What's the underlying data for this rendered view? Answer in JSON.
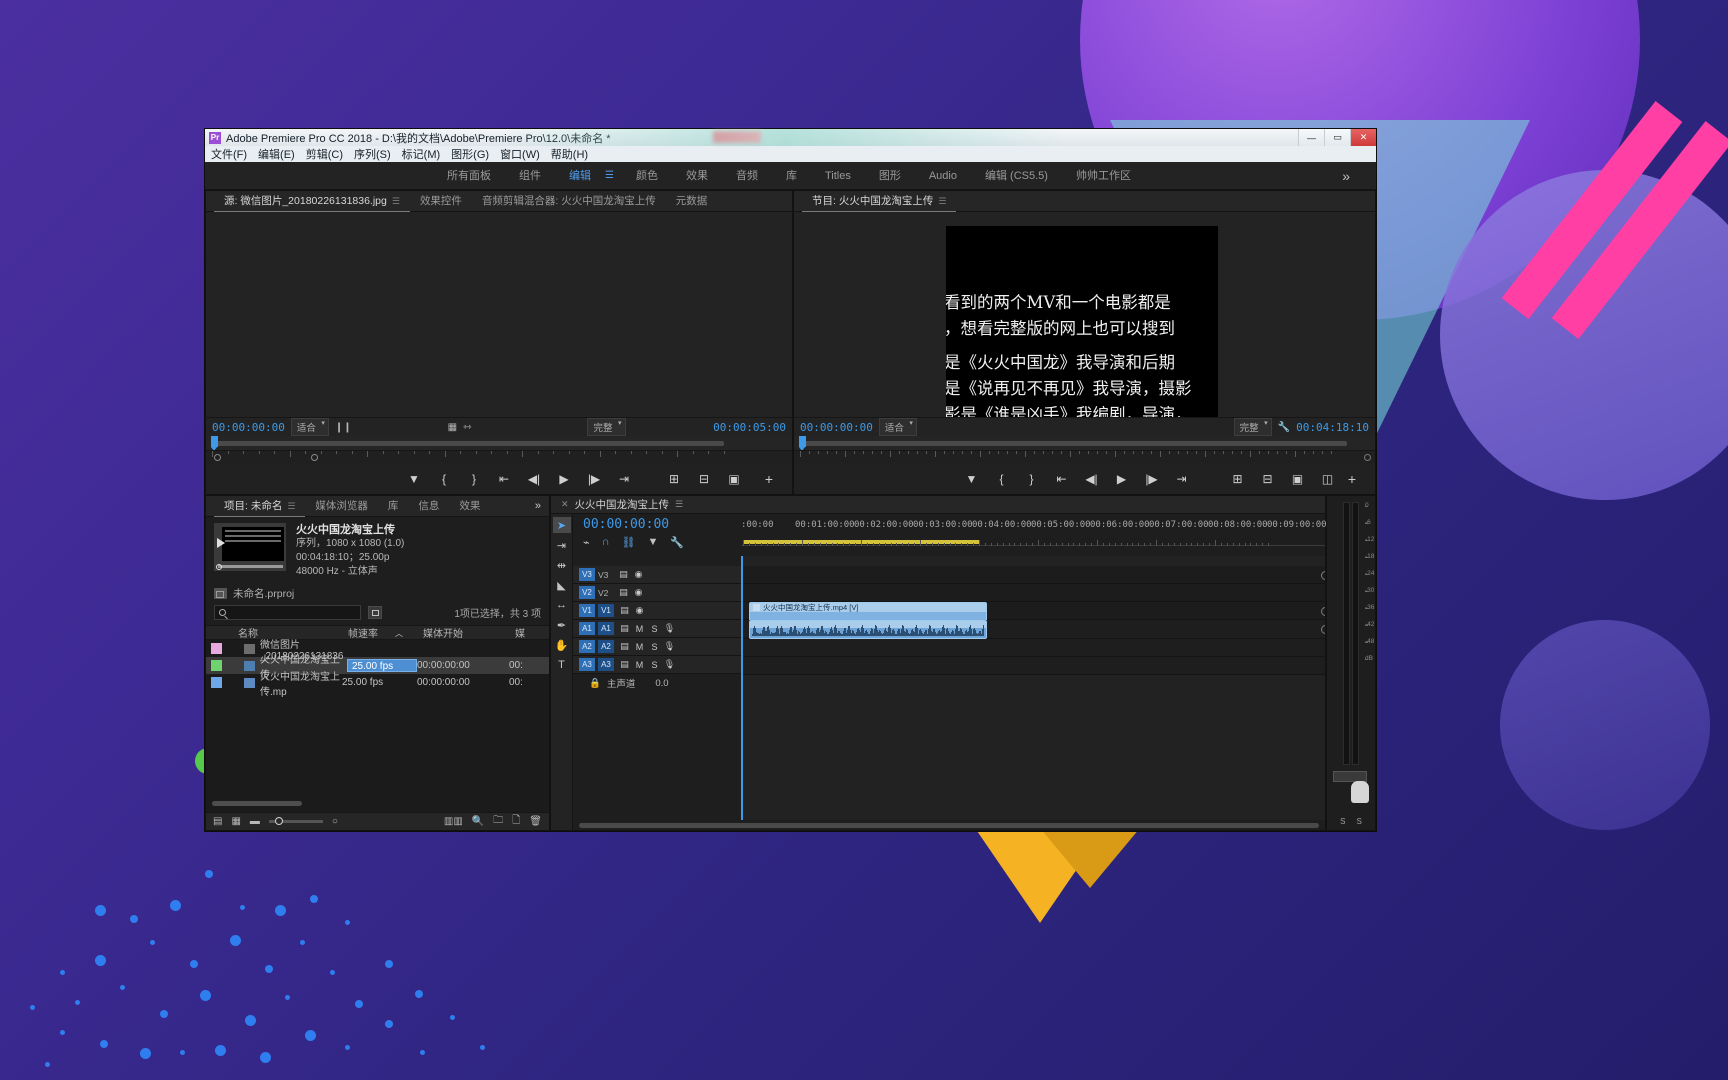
{
  "window": {
    "title": "Adobe Premiere Pro CC 2018 - D:\\我的文档\\Adobe\\Premiere Pro\\12.0\\未命名 *",
    "app_icon": "Pr",
    "buttons": {
      "minimize": "—",
      "maximize": "▭",
      "close": "✕"
    }
  },
  "menu": {
    "items": [
      "文件(F)",
      "编辑(E)",
      "剪辑(C)",
      "序列(S)",
      "标记(M)",
      "图形(G)",
      "窗口(W)",
      "帮助(H)"
    ]
  },
  "workspaces": {
    "tabs": [
      {
        "label": "所有面板",
        "active": false
      },
      {
        "label": "组件",
        "active": false
      },
      {
        "label": "编辑",
        "active": true
      },
      {
        "label": "颜色",
        "active": false
      },
      {
        "label": "效果",
        "active": false
      },
      {
        "label": "音频",
        "active": false
      },
      {
        "label": "库",
        "active": false
      },
      {
        "label": "Titles",
        "active": false
      },
      {
        "label": "图形",
        "active": false
      },
      {
        "label": "Audio",
        "active": false
      },
      {
        "label": "编辑 (CS5.5)",
        "active": false
      },
      {
        "label": "帅帅工作区",
        "active": false
      }
    ],
    "overflow": "»"
  },
  "source_panel": {
    "tabs": [
      {
        "label": "源: 微信图片_20180226131836.jpg",
        "active": true
      },
      {
        "label": "效果控件",
        "active": false
      },
      {
        "label": "音频剪辑混合器: 火火中国龙淘宝上传",
        "active": false
      },
      {
        "label": "元数据",
        "active": false
      }
    ],
    "timecode_left": "00:00:00:00",
    "fit": "适合",
    "quality": "完整",
    "timecode_right": "00:00:05:00"
  },
  "program_panel": {
    "tab": "节目: 火火中国龙淘宝上传",
    "timecode_left": "00:00:00:00",
    "fit": "适合",
    "quality": "完整",
    "timecode_right": "00:04:18:10",
    "video_lines": [
      "看到的两个MV和一个电影都是",
      "，想看完整版的网上也可以搜到",
      "是《火火中国龙》我导演和后期",
      "是《说再见不再见》我导演，摄影",
      "影是《谁是凶手》我编剧，导演，"
    ]
  },
  "project_panel": {
    "tabs": [
      {
        "label": "项目: 未命名",
        "active": true
      },
      {
        "label": "媒体浏览器",
        "active": false
      },
      {
        "label": "库",
        "active": false
      },
      {
        "label": "信息",
        "active": false
      },
      {
        "label": "效果",
        "active": false
      }
    ],
    "clip_preview": {
      "name": "火火中国龙淘宝上传",
      "line1": "序列，1080 x 1080 (1.0)",
      "line2": "00:04:18:10；25.00p",
      "line3": "48000 Hz - 立体声"
    },
    "project_file": "未命名.prproj",
    "search_placeholder": "",
    "selection_status": "1项已选择，共 3 项",
    "columns": [
      "名称",
      "帧速率",
      "媒体开始",
      "媒"
    ],
    "rows": [
      {
        "swatch": "#e8a8e0",
        "name": "微信图片_20180226131836",
        "rate": "",
        "media_start": "",
        "media_end": "",
        "selected": false,
        "editing": false
      },
      {
        "swatch": "#6fd46f",
        "name": "火火中国龙淘宝上传",
        "rate": "25.00 fps",
        "media_start": "00:00:00:00",
        "media_end": "00:",
        "selected": true,
        "editing": true
      },
      {
        "swatch": "#6fa8e8",
        "name": "火火中国龙淘宝上传.mp",
        "rate": "25.00 fps",
        "media_start": "00:00:00:00",
        "media_end": "00:",
        "selected": false,
        "editing": false
      }
    ]
  },
  "timeline": {
    "tab": "火火中国龙淘宝上传",
    "timecode": "00:00:00:00",
    "ruler_labels": [
      ":00:00",
      "00:01:00:00",
      "00:02:00:00",
      "00:03:00:00",
      "00:04:00:00",
      "00:05:00:00",
      "00:06:00:00",
      "00:07:00:00",
      "00:08:00:00",
      "00:09:00:00"
    ],
    "video_tracks": [
      {
        "badge": "V3",
        "label": "V3"
      },
      {
        "badge": "V2",
        "label": "V2"
      },
      {
        "badge": "V1",
        "label": "V1"
      }
    ],
    "audio_tracks": [
      {
        "badge": "A1",
        "label": "A1"
      },
      {
        "badge": "A2",
        "label": "A2"
      },
      {
        "badge": "A3",
        "label": "A3"
      }
    ],
    "master_label": "主声道",
    "master_value": "0.0",
    "clip_video_label": "火火中国龙淘宝上传.mp4 [V]",
    "track_icons": {
      "mute": "M",
      "solo": "S",
      "mic": "🎤",
      "lock": "🔒",
      "eye": "👁",
      "sync": "⛓"
    }
  },
  "tools": [
    {
      "name": "selection-tool",
      "glyph": "➤",
      "active": true
    },
    {
      "name": "track-select-forward-tool",
      "glyph": "⇥"
    },
    {
      "name": "ripple-edit-tool",
      "glyph": "⇹"
    },
    {
      "name": "razor-tool",
      "glyph": "◣"
    },
    {
      "name": "slip-tool",
      "glyph": "↔"
    },
    {
      "name": "pen-tool",
      "glyph": "✒"
    },
    {
      "name": "hand-tool",
      "glyph": "✋"
    },
    {
      "name": "type-tool",
      "glyph": "T"
    }
  ],
  "audio_meter": {
    "ticks": [
      "0",
      "-6",
      "-12",
      "-18",
      "-24",
      "-30",
      "-36",
      "-42",
      "-48",
      "dB"
    ],
    "channels": [
      "S",
      "S"
    ]
  },
  "colors": {
    "accent_blue": "#3c9ae8",
    "panel_bg": "#1e1e1e",
    "tab_bg": "#262626",
    "clip_blue": "#7fb2e0",
    "work_area_yellow": "#d4c23a"
  }
}
